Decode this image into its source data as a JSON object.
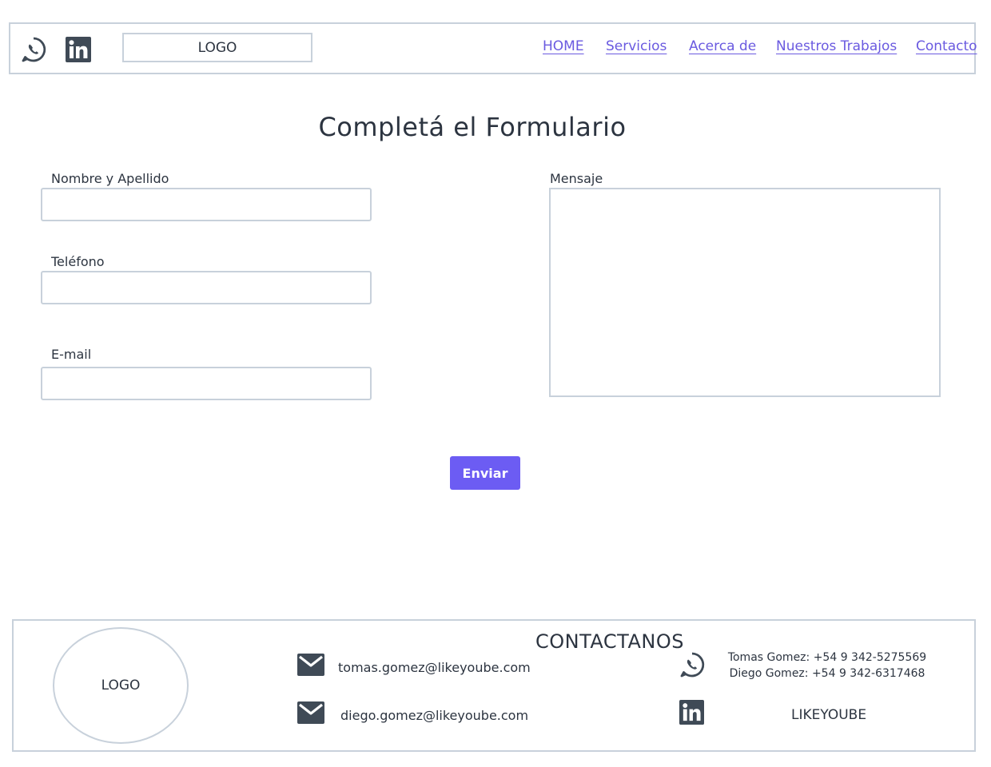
{
  "header": {
    "logo_label": "LOGO",
    "nav": [
      "HOME",
      "Servicios",
      "Acerca de",
      "Nuestros Trabajos",
      "Contacto"
    ]
  },
  "form": {
    "title": "Completá el Formulario",
    "fields": {
      "name_label": "Nombre y Apellido",
      "phone_label": "Teléfono",
      "email_label": "E-mail",
      "message_label": "Mensaje"
    },
    "submit_label": "Enviar"
  },
  "footer": {
    "logo_label": "LOGO",
    "title": "CONTACTANOS",
    "emails": [
      "tomas.gomez@likeyoube.com",
      "diego.gomez@likeyoube.com"
    ],
    "phones": [
      "Tomas Gomez: +54 9 342-5275569",
      "Diego Gomez: +54 9 342-6317468"
    ],
    "brand": "LIKEYOUBE"
  },
  "icons": {
    "whatsapp": "whatsapp-icon",
    "linkedin": "linkedin-icon",
    "mail": "mail-icon"
  },
  "colors": {
    "accent": "#6c5cf3",
    "link": "#6a5ae0",
    "border": "#c8d1db",
    "icon": "#3f4a56"
  }
}
